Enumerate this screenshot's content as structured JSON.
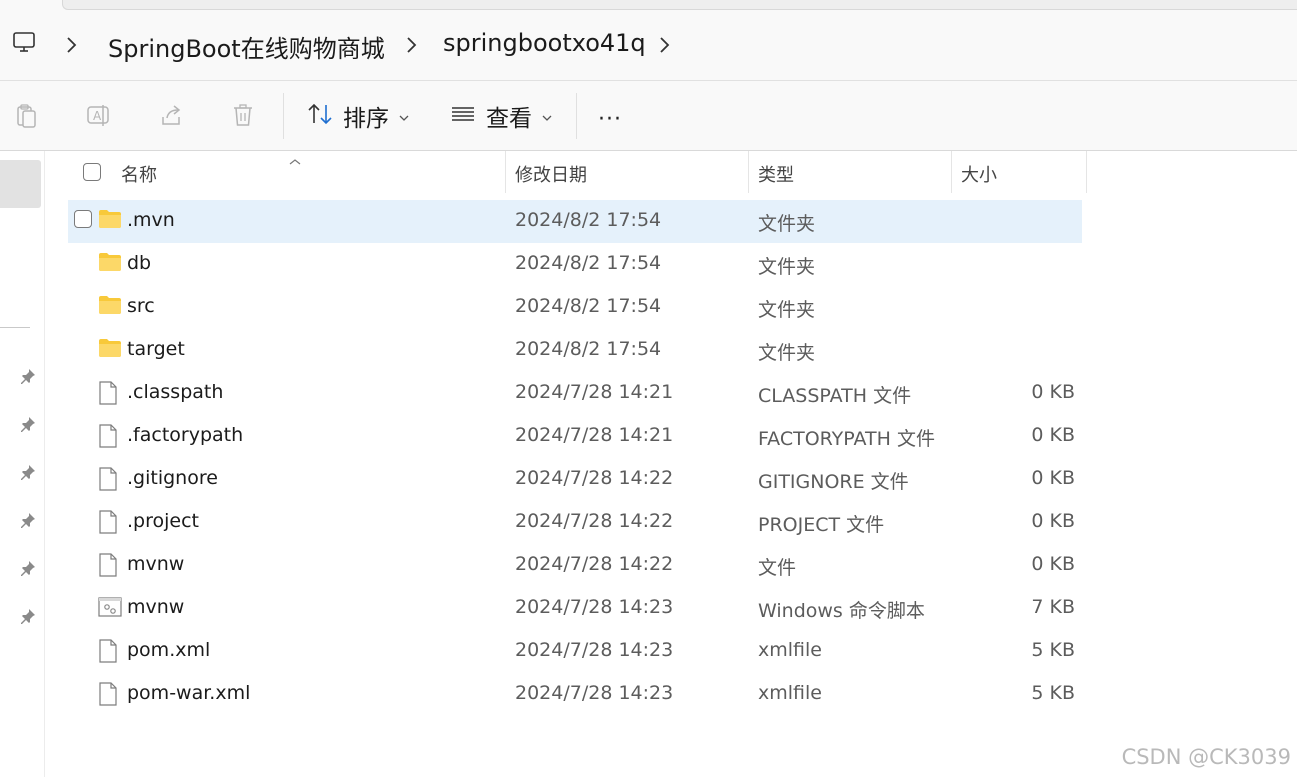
{
  "breadcrumb": {
    "items": [
      "SpringBoot在线购物商城",
      "springbootxo41q"
    ]
  },
  "toolbar": {
    "sort_label": "排序",
    "view_label": "查看",
    "more_label": "···"
  },
  "columns": {
    "name": "名称",
    "date": "修改日期",
    "type": "类型",
    "size": "大小"
  },
  "files": [
    {
      "name": ".mvn",
      "date": "2024/8/2 17:54",
      "type": "文件夹",
      "size": "",
      "icon": "folder-icon",
      "selected": true
    },
    {
      "name": "db",
      "date": "2024/8/2 17:54",
      "type": "文件夹",
      "size": "",
      "icon": "folder-icon"
    },
    {
      "name": "src",
      "date": "2024/8/2 17:54",
      "type": "文件夹",
      "size": "",
      "icon": "folder-icon"
    },
    {
      "name": "target",
      "date": "2024/8/2 17:54",
      "type": "文件夹",
      "size": "",
      "icon": "folder-icon"
    },
    {
      "name": ".classpath",
      "date": "2024/7/28 14:21",
      "type": "CLASSPATH 文件",
      "size": "0 KB",
      "icon": "file-icon"
    },
    {
      "name": ".factorypath",
      "date": "2024/7/28 14:21",
      "type": "FACTORYPATH 文件",
      "size": "0 KB",
      "icon": "file-icon"
    },
    {
      "name": ".gitignore",
      "date": "2024/7/28 14:22",
      "type": "GITIGNORE 文件",
      "size": "0 KB",
      "icon": "file-icon"
    },
    {
      "name": ".project",
      "date": "2024/7/28 14:22",
      "type": "PROJECT 文件",
      "size": "0 KB",
      "icon": "file-icon"
    },
    {
      "name": "mvnw",
      "date": "2024/7/28 14:22",
      "type": "文件",
      "size": "0 KB",
      "icon": "file-icon"
    },
    {
      "name": "mvnw",
      "date": "2024/7/28 14:23",
      "type": "Windows 命令脚本",
      "size": "7 KB",
      "icon": "script-icon"
    },
    {
      "name": "pom.xml",
      "date": "2024/7/28 14:23",
      "type": "xmlfile",
      "size": "5 KB",
      "icon": "file-icon"
    },
    {
      "name": "pom-war.xml",
      "date": "2024/7/28 14:23",
      "type": "xmlfile",
      "size": "5 KB",
      "icon": "file-icon"
    }
  ],
  "watermark": "CSDN @CK3039",
  "colors": {
    "selected_row": "#e5f1fb",
    "folder": "#f8c93a",
    "accent": "#1f6fd0"
  }
}
